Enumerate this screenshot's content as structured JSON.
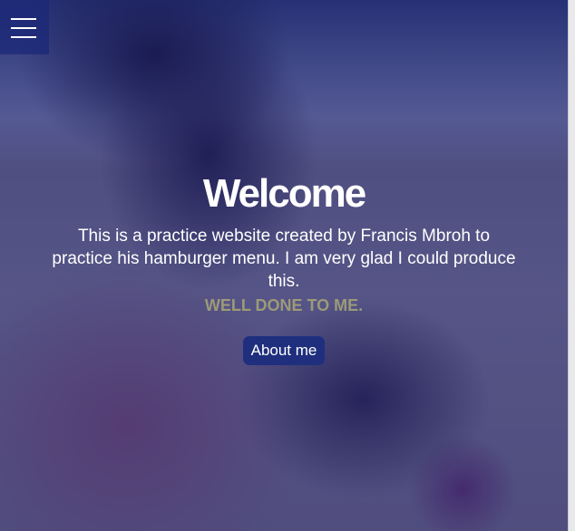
{
  "nav": {
    "menu_icon": "hamburger-menu-icon"
  },
  "hero": {
    "title": "Welcome",
    "description": "This is a practice website created by Francis Mbroh to practice his hamburger menu. I am very glad I could produce this.",
    "highlight": "WELL DONE TO ME.",
    "button_label": "About me"
  },
  "colors": {
    "overlay": "#1a2076",
    "highlight_text": "#9c9a78",
    "button_bg": "#1f2f7e"
  }
}
